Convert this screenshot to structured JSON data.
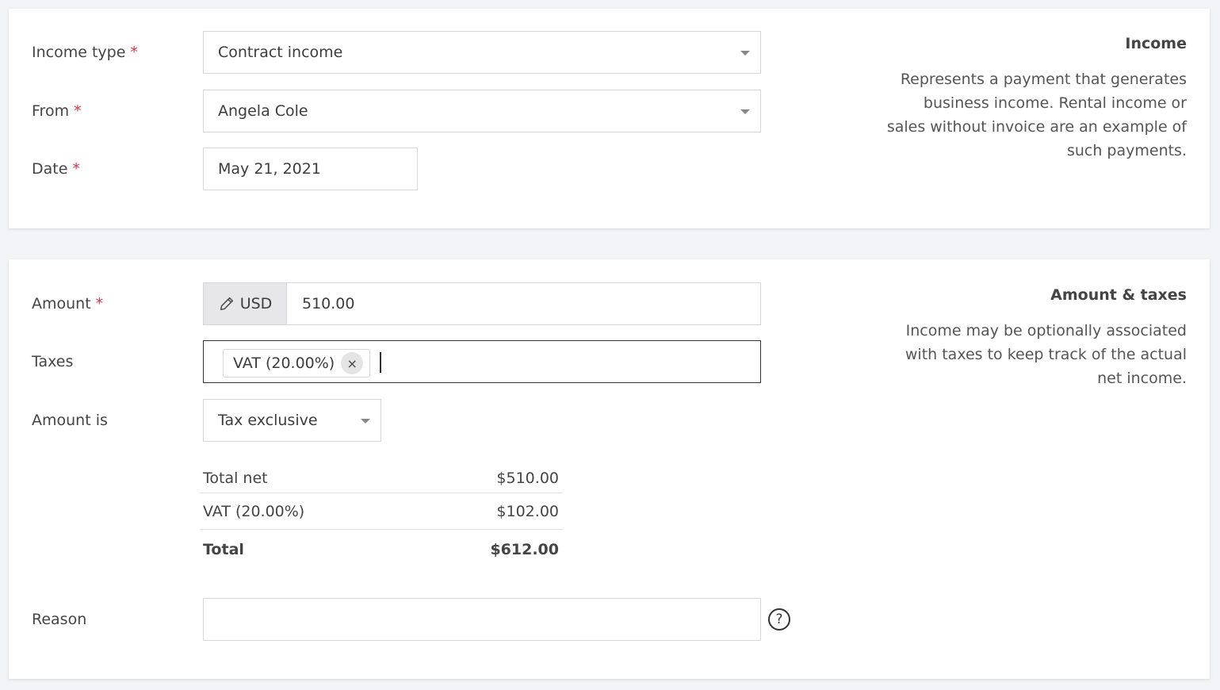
{
  "income_section": {
    "income_type": {
      "label": "Income type",
      "required": "*",
      "value": "Contract income"
    },
    "from": {
      "label": "From",
      "required": "*",
      "value": "Angela Cole"
    },
    "date": {
      "label": "Date",
      "required": "*",
      "value": "May 21, 2021"
    },
    "side": {
      "title": "Income",
      "description": "Represents a payment that generates business income. Rental income or sales without invoice are an example of such payments."
    }
  },
  "amount_section": {
    "amount": {
      "label": "Amount",
      "required": "*",
      "currency": "USD",
      "value": "510.00"
    },
    "taxes": {
      "label": "Taxes",
      "tag": "VAT (20.00%)",
      "remove_glyph": "×"
    },
    "amount_is": {
      "label": "Amount is",
      "value": "Tax exclusive"
    },
    "totals": [
      {
        "label": "Total net",
        "value": "$510.00"
      },
      {
        "label": "VAT (20.00%)",
        "value": "$102.00"
      },
      {
        "label": "Total",
        "value": "$612.00"
      }
    ],
    "reason": {
      "label": "Reason",
      "value": "",
      "help_glyph": "?"
    },
    "side": {
      "title": "Amount & taxes",
      "description": "Income may be optionally associated with taxes to keep track of the actual net income."
    }
  },
  "colors": {
    "required": "#d0344a",
    "addon_bg": "#e7e7e9",
    "page_bg": "#f3f4f7"
  },
  "icons": {
    "currency_edit": "pencil-icon",
    "dropdown": "chevron-down-icon",
    "help": "question-circle-icon",
    "remove": "close-icon"
  }
}
